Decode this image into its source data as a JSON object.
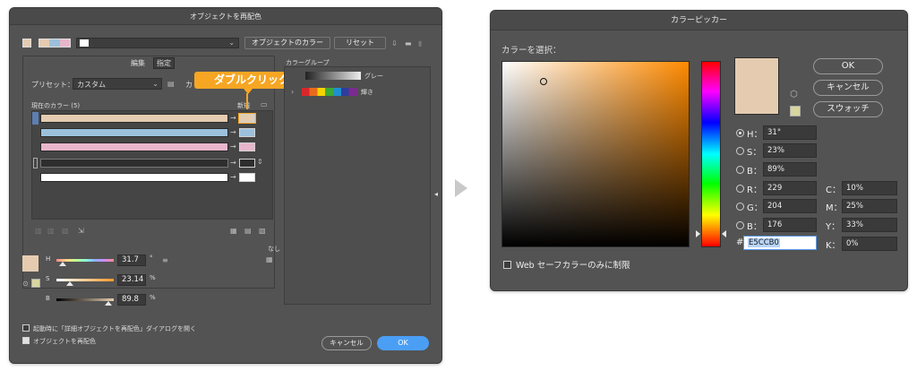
{
  "recolor": {
    "title": "オブジェクトを再配色",
    "object_colors_label": "オブジェクトのカラー",
    "reset_label": "リセット",
    "tab_edit": "編集",
    "tab_assign": "指定",
    "preset_label": "プリセット：",
    "preset_value": "カスタム",
    "colors_label_fragment": "カ",
    "current_colors_label": "現在のカラー (5)",
    "new_label": "新規",
    "color_group_label": "カラーグループ",
    "group1_name": "グレー",
    "group2_name": "輝き",
    "callout": "ダブルクリック",
    "none_label": "なし",
    "h_label": "H",
    "h_value": "31.7",
    "h_unit": "°",
    "s_label": "S",
    "s_value": "23.14",
    "s_unit": "%",
    "b_label": "B",
    "b_value": "89.8",
    "b_unit": "%",
    "checkbox1_label": "起動時に「詳細オブジェクトを再配色」ダイアログを開く",
    "checkbox2_label": "オブジェクトを再配色",
    "cancel_label": "キャンセル",
    "ok_label": "OK",
    "rows": [
      {
        "current": "#e5ccb0",
        "new": "#e5ccb0"
      },
      {
        "current": "#9cc0dc",
        "new": "#9cc0dc"
      },
      {
        "current": "#e8b6cc",
        "new": "#e8b6cc"
      },
      {
        "current": "#2e2e2e",
        "new": "#2e2e2e"
      },
      {
        "current": "#ffffff",
        "new": "#ffffff"
      }
    ],
    "swatch_color": "#e5ccb0",
    "accent": "#4a9ff5",
    "callout_color": "#f6a623"
  },
  "picker": {
    "title": "カラーピッカー",
    "select_label": "カラーを選択：",
    "ok_label": "OK",
    "cancel_label": "キャンセル",
    "swatches_label": "スウォッチ",
    "h_label": "H：",
    "h_value": "31°",
    "s_label": "S：",
    "s_value": "23%",
    "b_label": "B：",
    "b_value": "89%",
    "r_label": "R：",
    "r_value": "229",
    "g_label": "G：",
    "g_value": "204",
    "bl_label": "B：",
    "bl_value": "176",
    "c_label": "C：",
    "c_value": "10%",
    "m_label": "M：",
    "m_value": "25%",
    "y_label": "Y：",
    "y_value": "33%",
    "k_label": "K：",
    "k_value": "0%",
    "hash_label": "#",
    "hex_value": "E5CCB0",
    "web_safe_label": "Web セーフカラーのみに制限",
    "hue_color": "#ff8a00",
    "selected_color": "#e5ccb0"
  }
}
